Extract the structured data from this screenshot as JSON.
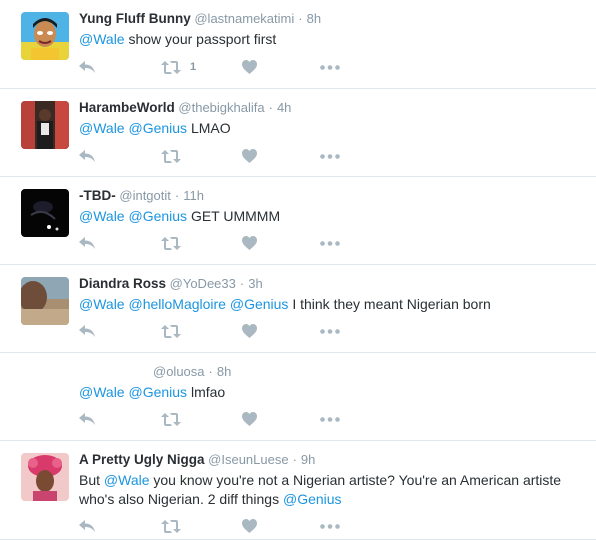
{
  "tweets": [
    {
      "name": "Yung Fluff Bunny",
      "handle": "@lastnamekatimi",
      "time": "8h",
      "avatar_icon": "cartoon-avatar",
      "parts": [
        {
          "t": "@Wale",
          "m": true
        },
        {
          "t": " show your passport first",
          "m": false
        }
      ],
      "retweet_count": "1"
    },
    {
      "name": "HarambeWorld",
      "handle": "@thebigkhalifa",
      "time": "4h",
      "avatar_icon": "photo-avatar",
      "parts": [
        {
          "t": "@Wale",
          "m": true
        },
        {
          "t": " ",
          "m": false
        },
        {
          "t": "@Genius",
          "m": true
        },
        {
          "t": " LMAO",
          "m": false
        }
      ],
      "retweet_count": ""
    },
    {
      "name": "-TBD-",
      "handle": "@intgotit",
      "time": "11h",
      "avatar_icon": "dark-photo-avatar",
      "parts": [
        {
          "t": "@Wale",
          "m": true
        },
        {
          "t": " ",
          "m": false
        },
        {
          "t": "@Genius",
          "m": true
        },
        {
          "t": " GET UMMMM",
          "m": false
        }
      ],
      "retweet_count": ""
    },
    {
      "name": "Diandra Ross",
      "handle": "@YoDee33",
      "time": "3h",
      "avatar_icon": "beach-photo-avatar",
      "parts": [
        {
          "t": "@Wale",
          "m": true
        },
        {
          "t": " ",
          "m": false
        },
        {
          "t": "@helloMagloire",
          "m": true
        },
        {
          "t": " ",
          "m": false
        },
        {
          "t": "@Genius",
          "m": true
        },
        {
          "t": " I think they meant Nigerian born",
          "m": false
        }
      ],
      "retweet_count": ""
    },
    {
      "name": "",
      "handle": "@oluosa",
      "time": "8h",
      "avatar_icon": "",
      "parts": [
        {
          "t": "@Wale",
          "m": true
        },
        {
          "t": " ",
          "m": false
        },
        {
          "t": "@Genius",
          "m": true
        },
        {
          "t": " lmfao",
          "m": false
        }
      ],
      "retweet_count": ""
    },
    {
      "name": "A Pretty Ugly Nigga",
      "handle": "@IseunLuese",
      "time": "9h",
      "avatar_icon": "pink-headwrap-avatar",
      "parts": [
        {
          "t": "But ",
          "m": false
        },
        {
          "t": "@Wale",
          "m": true
        },
        {
          "t": " you know you're not a Nigerian artiste? You're an American artiste who's also Nigerian. 2 diff things ",
          "m": false
        },
        {
          "t": "@Genius",
          "m": true
        }
      ],
      "retweet_count": ""
    }
  ],
  "separator": "·",
  "icons": [
    "reply-icon",
    "retweet-icon",
    "like-icon",
    "more-icon"
  ],
  "colors": {
    "mention": "#1b95e0",
    "muted": "#8899a6",
    "icon": "#aab8c2",
    "border": "#e1e8ed"
  }
}
